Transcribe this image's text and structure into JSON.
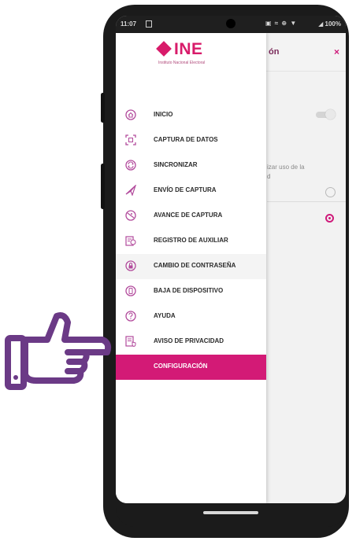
{
  "status_bar": {
    "time": "11:07",
    "icons": "▣ ≈ ⊕ ▼",
    "battery": "◢ 100%"
  },
  "background_screen": {
    "title_fragment": "ón",
    "close_label": "×",
    "option_text_line1": "izar uso de la",
    "option_text_line2": "d"
  },
  "drawer": {
    "logo": {
      "name": "INE",
      "subtitle": "Instituto Nacional Electoral"
    },
    "items": [
      {
        "label": "INICIO",
        "icon": "home-icon"
      },
      {
        "label": "CAPTURA DE DATOS",
        "icon": "scan-icon"
      },
      {
        "label": "SINCRONIZAR",
        "icon": "sync-icon"
      },
      {
        "label": "ENVÍO DE CAPTURA",
        "icon": "send-icon"
      },
      {
        "label": "AVANCE DE CAPTURA",
        "icon": "progress-icon"
      },
      {
        "label": "REGISTRO DE AUXILIAR",
        "icon": "register-user-icon"
      },
      {
        "label": "CAMBIO DE CONTRASEÑA",
        "icon": "password-icon"
      },
      {
        "label": "BAJA DE DISPOSITIVO",
        "icon": "device-off-icon"
      },
      {
        "label": "AYUDA",
        "icon": "help-icon"
      },
      {
        "label": "AVISO DE PRIVACIDAD",
        "icon": "privacy-icon"
      },
      {
        "label": "CONFIGURACIÓN",
        "icon": "settings-icon",
        "active": true
      }
    ]
  },
  "colors": {
    "accent": "#d31a76",
    "icon": "#b24a9c",
    "hand": "#6b3a86"
  }
}
